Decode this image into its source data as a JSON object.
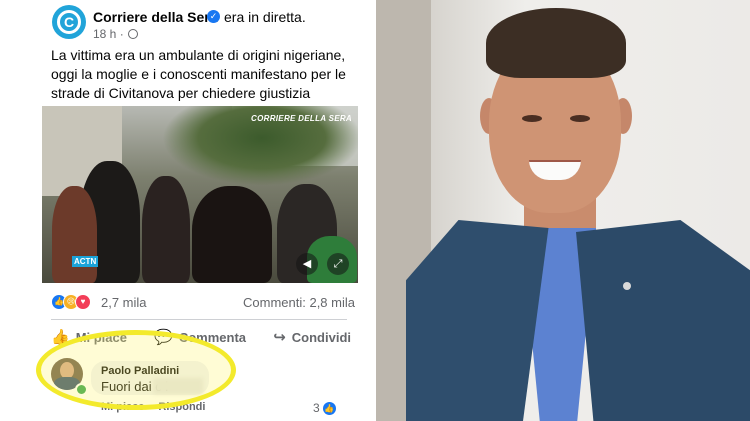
{
  "post": {
    "page_name": "Corriere della Sera",
    "status": "era in diretta.",
    "time": "18 h ·",
    "text": "La vittima era un ambulante di origini nigeriane, oggi la moglie e i conoscenti manifestano per le strade di Civitanova per chiedere giustizia",
    "video_watermark": "CORRIERE DELLA SERA",
    "video_badge": "ACTN"
  },
  "stats": {
    "reactions_count": "2,7 mila",
    "comments": "Commenti: 2,8 mila",
    "reaction_icons": [
      "like-icon",
      "sad-icon",
      "love-icon"
    ]
  },
  "actions": {
    "like": "Mi piace",
    "comment": "Commenta",
    "share": "Condividi"
  },
  "comment": {
    "author": "Paolo Palladini",
    "text_visible": "Fuori dai c     i",
    "like_label": "Mi piace",
    "reply_label": "Rispondi",
    "likes": "3"
  },
  "colors": {
    "facebook_blue": "#1877f2",
    "brand_cyan": "#21a4d9",
    "highlight_yellow": "#f3ea2c",
    "muted_text": "#65676b"
  }
}
